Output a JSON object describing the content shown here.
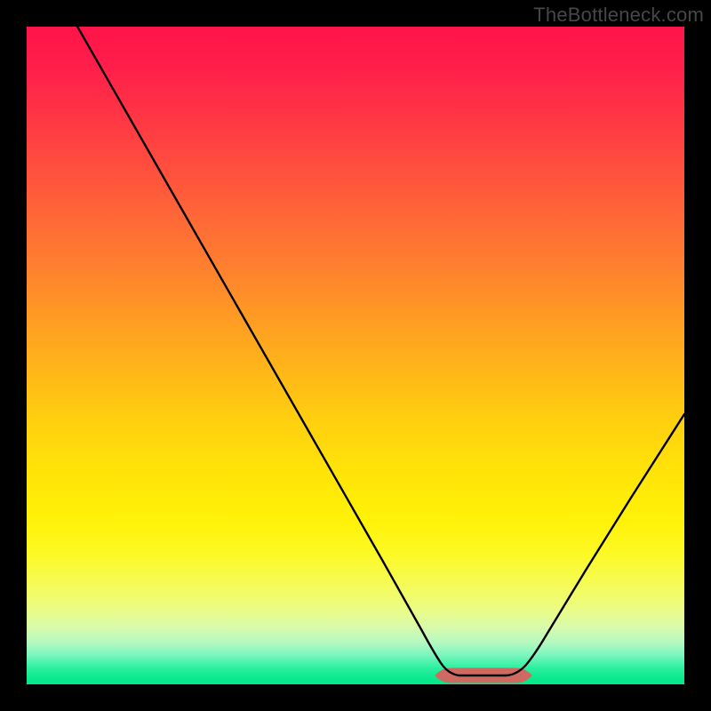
{
  "watermark": "TheBottleneck.com",
  "colors": {
    "frame": "#000000",
    "curve_stroke": "#000000",
    "optimal_marker": "#cf6a63"
  },
  "chart_data": {
    "type": "line",
    "title": "",
    "xlabel": "",
    "ylabel": "",
    "xlim": [
      0,
      100
    ],
    "ylim": [
      0,
      100
    ],
    "note": "V-shaped bottleneck curve. y≈0 (green zone) indicates optimal hardware balance; higher y (toward red) indicates greater bottleneck.",
    "series": [
      {
        "name": "bottleneck-curve",
        "x": [
          0,
          5,
          10,
          15,
          20,
          25,
          30,
          35,
          40,
          45,
          50,
          55,
          60,
          63,
          66,
          69,
          72,
          75,
          80,
          85,
          90,
          95,
          100
        ],
        "y": [
          103,
          95,
          87,
          79,
          71,
          63,
          55,
          47,
          39,
          31,
          23,
          15,
          7,
          2,
          0,
          0,
          0,
          2,
          9,
          17,
          25,
          33,
          41
        ]
      }
    ],
    "optimal_range": {
      "x_start": 63,
      "x_end": 75
    },
    "gradient_stops": [
      {
        "pct": 0,
        "color": "#ff1449"
      },
      {
        "pct": 50,
        "color": "#ffc015"
      },
      {
        "pct": 80,
        "color": "#fff520"
      },
      {
        "pct": 100,
        "color": "#04e788"
      }
    ]
  }
}
